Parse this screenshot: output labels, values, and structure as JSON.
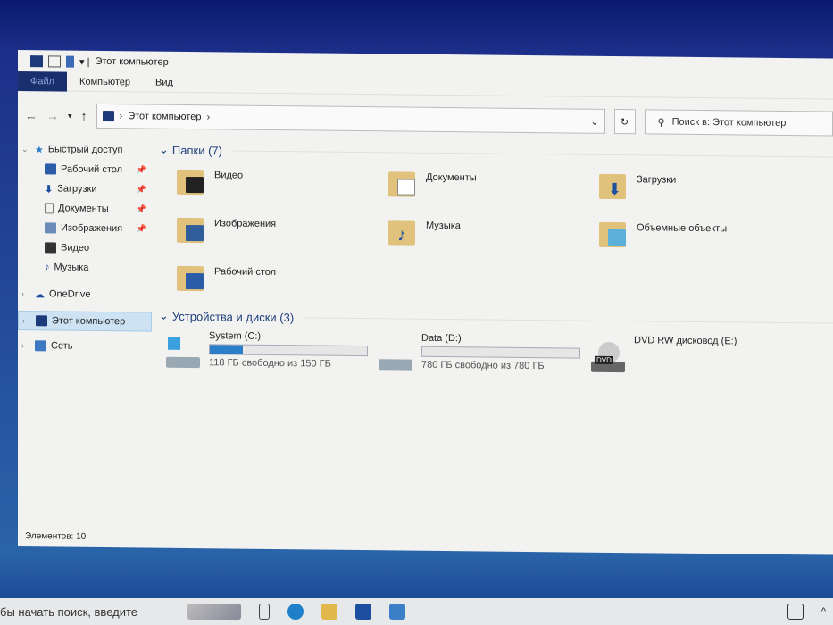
{
  "window": {
    "title": "Этот компьютер"
  },
  "ribbon": {
    "tabs": [
      "Файл",
      "Компьютер",
      "Вид"
    ]
  },
  "address": {
    "path": "Этот компьютер",
    "search_placeholder": "Поиск в: Этот компьютер"
  },
  "nav": {
    "quick_access": "Быстрый доступ",
    "quick_items": [
      "Рабочий стол",
      "Загрузки",
      "Документы",
      "Изображения",
      "Видео",
      "Музыка"
    ],
    "onedrive": "OneDrive",
    "this_pc": "Этот компьютер",
    "network": "Сеть"
  },
  "folders": {
    "header": "Папки (7)",
    "items": [
      "Видео",
      "Документы",
      "Загрузки",
      "Изображения",
      "Музыка",
      "Объемные объекты",
      "Рабочий стол"
    ]
  },
  "devices": {
    "header": "Устройства и диски (3)",
    "drives": [
      {
        "name": "System (C:)",
        "info": "118 ГБ свободно из 150 ГБ",
        "used_fraction": 0.21
      },
      {
        "name": "Data (D:)",
        "info": "780 ГБ свободно из 780 ГБ",
        "used_fraction": 0.0
      },
      {
        "name": "DVD RW дисковод (E:)",
        "badge": "DVD"
      }
    ]
  },
  "status": {
    "count": "Элементов: 10"
  },
  "taskbar": {
    "search": "бы начать поиск, введите"
  },
  "colors": {
    "accent": "#2a7fc8",
    "file_tab": "#1a2f6e"
  }
}
